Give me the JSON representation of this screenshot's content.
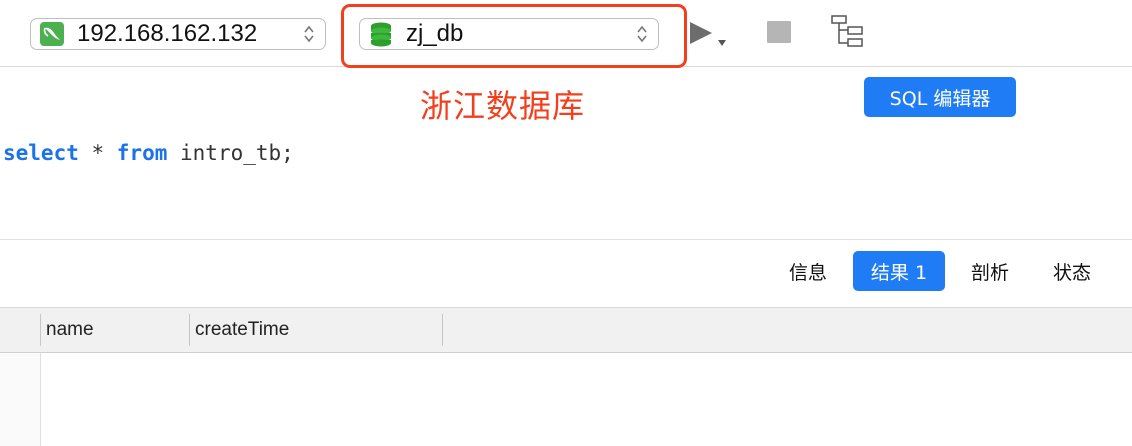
{
  "toolbar": {
    "connection": {
      "value": "192.168.162.132",
      "icon": "dolphin-icon"
    },
    "database": {
      "value": "zj_db",
      "icon": "database-stack-icon"
    },
    "run_icon": "play-icon",
    "stop_icon": "stop-icon",
    "explain_icon": "explain-tree-icon"
  },
  "annotation": {
    "text": "浙江数据库",
    "color": "#f2401e"
  },
  "sql_editor_button": {
    "label": "SQL 编辑器"
  },
  "editor": {
    "keyword_select": "select",
    "star": " * ",
    "keyword_from": "from",
    "rest": " intro_tb;"
  },
  "result_tabs": [
    {
      "label": "信息"
    },
    {
      "label": "结果 1",
      "active": true
    },
    {
      "label": "剖析"
    },
    {
      "label": "状态"
    }
  ],
  "grid": {
    "columns": [
      "name",
      "createTime"
    ]
  },
  "colors": {
    "accent": "#1f7cf5",
    "highlight": "#f2401e"
  }
}
